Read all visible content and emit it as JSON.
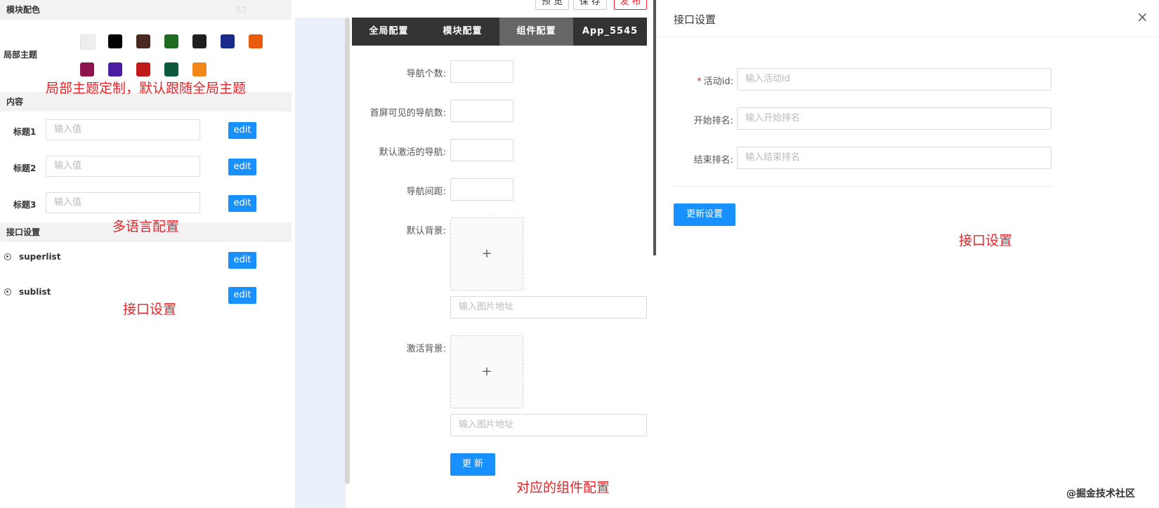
{
  "left": {
    "module_color_header": "模块配色",
    "faded_number": "57",
    "local_theme_label": "局部主题",
    "swatches_row1": [
      "#eeeeee",
      "#000000",
      "#4a2a20",
      "#1f6b22",
      "#1f1f1f",
      "#1a2a8a",
      "#e85a0c"
    ],
    "swatches_row2": [
      "#8c1550",
      "#4a1da0",
      "#c11a1a",
      "#0b5a3e",
      "#f0871a"
    ],
    "content_header": "内容",
    "fields": [
      {
        "label": "标题1",
        "placeholder": "输入值",
        "button": "edit"
      },
      {
        "label": "标题2",
        "placeholder": "输入值",
        "button": "edit"
      },
      {
        "label": "标题3",
        "placeholder": "输入值",
        "button": "edit"
      }
    ],
    "api_header": "接口设置",
    "apis": [
      {
        "name": "superlist",
        "button": "edit"
      },
      {
        "name": "sublist",
        "button": "edit"
      }
    ]
  },
  "notes": {
    "theme_note": "局部主题定制，默认跟随全局主题",
    "lang_note": "多语言配置",
    "api_note_left": "接口设置",
    "component_note": "对应的组件配置",
    "api_note_right": "接口设置"
  },
  "top_buttons": {
    "preview": "预 览",
    "save": "保 存",
    "publish": "发 布"
  },
  "tabs": [
    {
      "label": "全局配置",
      "active": false
    },
    {
      "label": "模块配置",
      "active": false
    },
    {
      "label": "组件配置",
      "active": true
    },
    {
      "label": "App_5545",
      "active": false
    }
  ],
  "component_form": {
    "nav_count_label": "导航个数:",
    "first_screen_label": "首屏可见的导航数:",
    "default_active_label": "默认激活的导航:",
    "nav_spacing_label": "导航间距:",
    "default_bg_label": "默认背景:",
    "active_bg_label": "激活背景:",
    "plus": "+",
    "image_url_placeholder": "输入图片地址",
    "update_button": "更 新"
  },
  "api_settings": {
    "title": "接口设置",
    "close": "×",
    "required_mark": "*",
    "activity_id_label": "活动id:",
    "activity_id_placeholder": "输入活动id",
    "start_rank_label": "开始排名:",
    "start_rank_placeholder": "输入开始排名",
    "end_rank_label": "结束排名:",
    "end_rank_placeholder": "输入结束排名",
    "update_button": "更新设置"
  },
  "watermark": "@掘金技术社区"
}
